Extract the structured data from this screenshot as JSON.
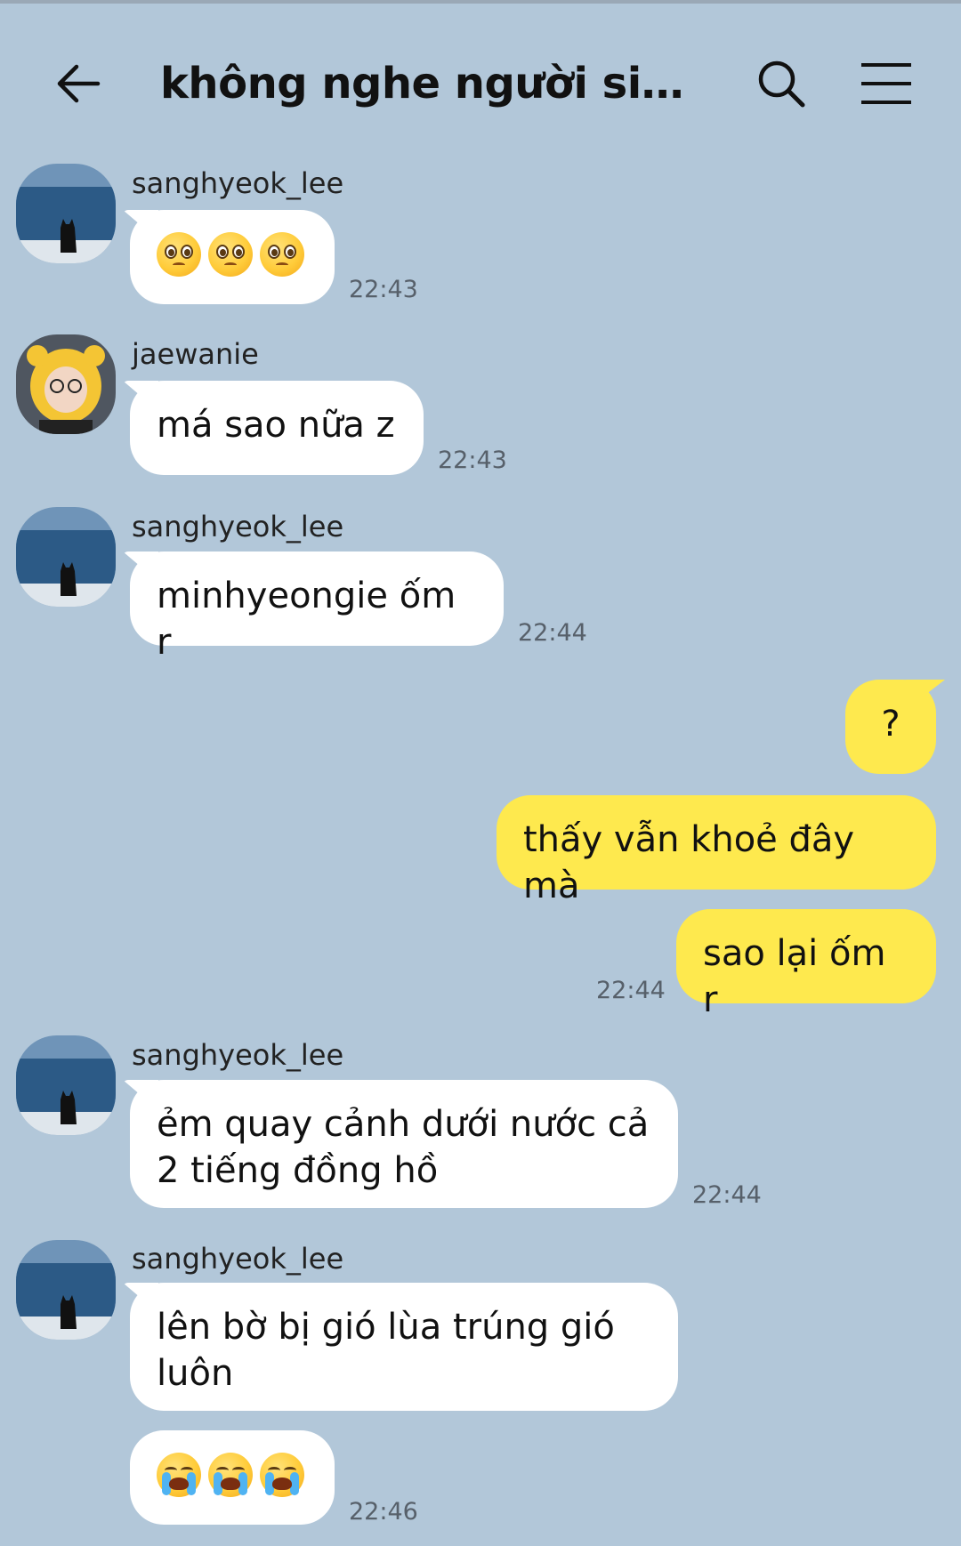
{
  "header": {
    "title": "không nghe người simp...",
    "back_icon": "arrow-left-icon",
    "search_icon": "search-icon",
    "menu_icon": "hamburger-menu-icon"
  },
  "colors": {
    "background": "#b2c7d9",
    "incoming_bubble": "#ffffff",
    "outgoing_bubble": "#fee94e"
  },
  "messages": [
    {
      "sender": "sanghyeok_lee",
      "emojis": [
        "pleading-face",
        "pleading-face",
        "pleading-face"
      ],
      "time": "22:43"
    },
    {
      "sender": "jaewanie",
      "text": "má sao nữa z",
      "time": "22:43"
    },
    {
      "sender": "sanghyeok_lee",
      "text": "minhyeongie ốm r",
      "time": "22:44"
    },
    {
      "outgoing": true,
      "text": "?"
    },
    {
      "outgoing": true,
      "text": "thấy vẫn khoẻ đây mà"
    },
    {
      "outgoing": true,
      "text": "sao lại ốm r",
      "time": "22:44"
    },
    {
      "sender": "sanghyeok_lee",
      "lines": [
        "ẻm quay cảnh dưới nước cả",
        "2 tiếng đồng hồ"
      ],
      "time": "22:44"
    },
    {
      "sender": "sanghyeok_lee",
      "lines": [
        "lên bờ bị gió lùa trúng gió",
        "luôn"
      ]
    },
    {
      "emojis": [
        "loudly-crying-face",
        "loudly-crying-face",
        "loudly-crying-face"
      ],
      "time": "22:46"
    }
  ]
}
